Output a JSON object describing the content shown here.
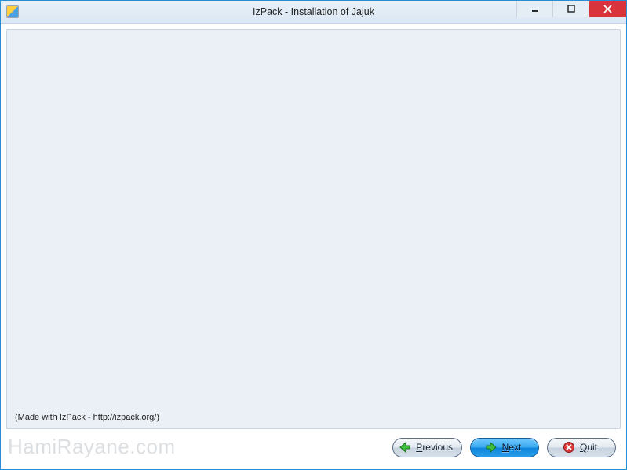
{
  "window": {
    "title": "IzPack - Installation of Jajuk"
  },
  "footer": {
    "made_with": "(Made with IzPack - http://izpack.org/)"
  },
  "buttons": {
    "previous": {
      "label": "Previous",
      "mnemonic": "P"
    },
    "next": {
      "label": "Next",
      "mnemonic": "N"
    },
    "quit": {
      "label": "Quit",
      "mnemonic": "Q"
    }
  },
  "watermark": "HamiRayane.com",
  "colors": {
    "window_border": "#2a8dd4",
    "panel_bg": "#eaf0f5",
    "blue_button": "#2a9de8",
    "close_button": "#d9343a"
  }
}
